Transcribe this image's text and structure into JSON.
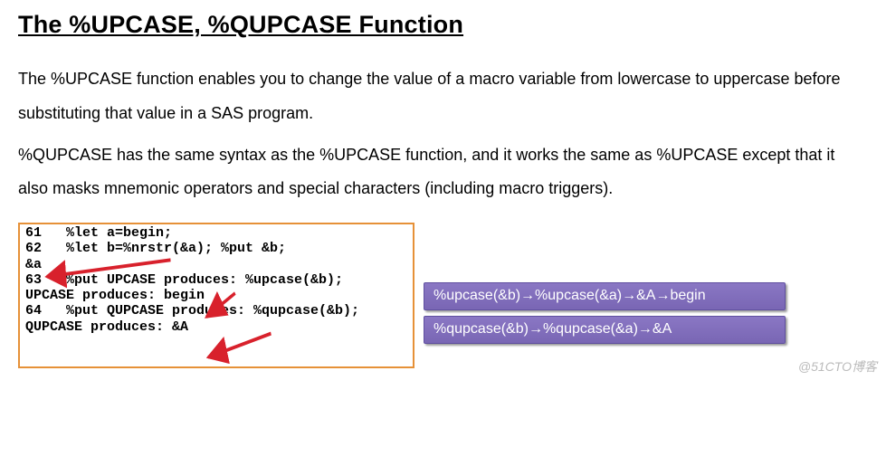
{
  "title": "The %UPCASE, %QUPCASE Function",
  "para1": "The %UPCASE function enables you to change the value of a macro variable from lowercase to uppercase before substituting that value in a SAS program.",
  "para2": "%QUPCASE has the same syntax as the %UPCASE function, and it works the same as %UPCASE except that it also masks mnemonic operators and special characters (including macro triggers).",
  "log": {
    "l1": "61   %let a=begin;",
    "l2": "62   %let b=%nrstr(&a); %put &b;",
    "l3": "&a",
    "l4": "63   %put UPCASE produces: %upcase(&b);",
    "l5": "UPCASE produces: begin",
    "l6": "64   %put QUPCASE produces: %qupcase(&b);",
    "l7": "QUPCASE produces: &A"
  },
  "callout1": "%upcase(&b)→%upcase(&a)→&A→begin",
  "callout2": "%qupcase(&b)→%qupcase(&a)→&A",
  "watermark": "@51CTO博客"
}
